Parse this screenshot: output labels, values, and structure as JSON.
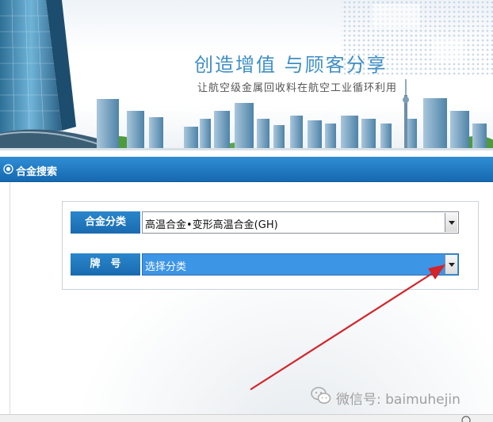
{
  "banner": {
    "slogan_main": "创造增值 与顾客分享",
    "slogan_sub": "让航空级金属回收料在航空工业循环利用"
  },
  "panel": {
    "title": "合金搜索",
    "header_icon": "radio-circle-icon"
  },
  "form": {
    "category": {
      "label": "合金分类",
      "selected": "高温合金•变形高温合金(GH)"
    },
    "grade": {
      "label": "牌　号",
      "selected": "选择分类"
    }
  },
  "annotation": {
    "type": "red-arrow",
    "color": "#d3242a"
  },
  "watermark": {
    "icon": "wechat-icon",
    "text": "微信号: baimuhejin"
  },
  "colors": {
    "header_blue": "#1a73be",
    "label_blue": "#1f78c1",
    "select_highlight": "#3d95e6",
    "slogan_blue": "#3f8fc4"
  }
}
